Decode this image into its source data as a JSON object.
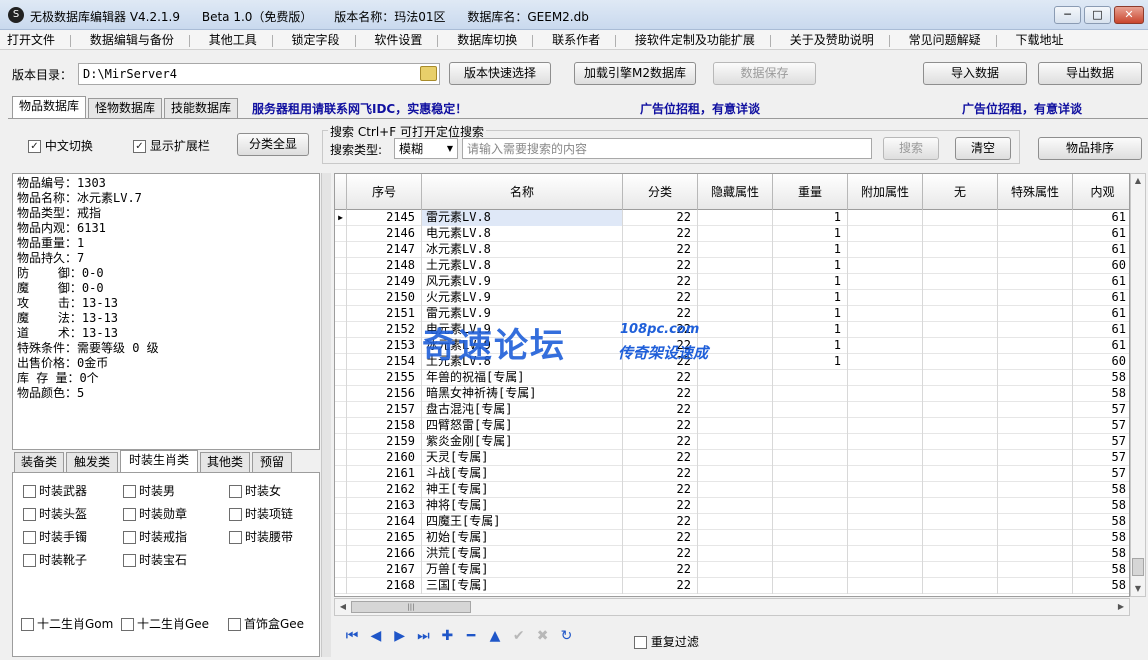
{
  "window": {
    "title_segments": [
      "无极数据库编辑器 V4.2.1.9",
      "Beta 1.0（免费版）",
      "版本名称：玛法01区",
      "数据库名：GEEM2.db"
    ],
    "controls": [
      "─",
      "□",
      "✕"
    ]
  },
  "menu": [
    "打开文件",
    "数据编辑与备份",
    "其他工具",
    "锁定字段",
    "软件设置",
    "数据库切换",
    "联系作者",
    "接软件定制及功能扩展",
    "关于及赞助说明",
    "常见问题解疑",
    "下载地址"
  ],
  "toolbar": {
    "dir_label": "版本目录：",
    "dir_value": "D:\\MirServer4",
    "quick_select": "版本快速选择",
    "load_engine": "加载引擎M2数据库",
    "save_data": "数据保存",
    "import_data": "导入数据",
    "export_data": "导出数据"
  },
  "tabs": [
    "物品数据库",
    "怪物数据库",
    "技能数据库"
  ],
  "ads": [
    "服务器租用请联系网飞IDC，实惠稳定！",
    "广告位招租，有意详谈",
    "广告位招租，有意详谈"
  ],
  "options": {
    "chinese_toggle": "中文切换",
    "show_ext_bar": "显示扩展栏",
    "show_all_categories": "分类全显"
  },
  "search": {
    "title": "搜索   Ctrl+F 可打开定位搜索",
    "type_label": "搜索类型:",
    "type_value": "模糊",
    "placeholder": "请输入需要搜索的内容",
    "search_button": "搜索",
    "clear_button": "清空",
    "sort_button": "物品排序"
  },
  "item_info": [
    "物品编号：1303",
    "物品名称：冰元素LV.7",
    "物品类型：戒指",
    "物品内观：6131",
    "物品重量：1",
    "物品持久：7",
    "防    御：0-0",
    "魔    御：0-0",
    "攻    击：13-13",
    "魔    法：13-13",
    "道    术：13-13",
    "特殊条件：需要等级 0 级",
    "出售价格：0金币",
    "库 存 量：0个",
    "物品颜色：5"
  ],
  "category_tabs": [
    "装备类",
    "触发类",
    "时装生肖类",
    "其他类",
    "预留"
  ],
  "category_checks": [
    [
      "时装武器",
      "时装男",
      "时装女"
    ],
    [
      "时装头盔",
      "时装勋章",
      "时装项链"
    ],
    [
      "时装手镯",
      "时装戒指",
      "时装腰带"
    ],
    [
      "时装靴子",
      "时装宝石"
    ]
  ],
  "bottom_checks": [
    "十二生肖Gom",
    "十二生肖Gee",
    "首饰盒Gee"
  ],
  "grid": {
    "columns": [
      "序号",
      "名称",
      "分类",
      "隐藏属性",
      "重量",
      "附加属性",
      "无",
      "特殊属性",
      "内观"
    ],
    "rows": [
      [
        "2145",
        "雷元素LV.8",
        "22",
        "",
        "1",
        "",
        "",
        "",
        "61"
      ],
      [
        "2146",
        "电元素LV.8",
        "22",
        "",
        "1",
        "",
        "",
        "",
        "61"
      ],
      [
        "2147",
        "冰元素LV.8",
        "22",
        "",
        "1",
        "",
        "",
        "",
        "61"
      ],
      [
        "2148",
        "土元素LV.8",
        "22",
        "",
        "1",
        "",
        "",
        "",
        "60"
      ],
      [
        "2149",
        "风元素LV.9",
        "22",
        "",
        "1",
        "",
        "",
        "",
        "61"
      ],
      [
        "2150",
        "火元素LV.9",
        "22",
        "",
        "1",
        "",
        "",
        "",
        "61"
      ],
      [
        "2151",
        "雷元素LV.9",
        "22",
        "",
        "1",
        "",
        "",
        "",
        "61"
      ],
      [
        "2152",
        "电元素LV.9",
        "22",
        "",
        "1",
        "",
        "",
        "",
        "61"
      ],
      [
        "2153",
        "冰元素LV.9",
        "22",
        "",
        "1",
        "",
        "",
        "",
        "61"
      ],
      [
        "2154",
        "土元素LV.8",
        "22",
        "",
        "1",
        "",
        "",
        "",
        "60"
      ],
      [
        "2155",
        "年兽的祝福[专属]",
        "22",
        "",
        "",
        "",
        "",
        "",
        "58"
      ],
      [
        "2156",
        "暗黑女神祈祷[专属]",
        "22",
        "",
        "",
        "",
        "",
        "",
        "58"
      ],
      [
        "2157",
        "盘古混沌[专属]",
        "22",
        "",
        "",
        "",
        "",
        "",
        "57"
      ],
      [
        "2158",
        "四臂怒雷[专属]",
        "22",
        "",
        "",
        "",
        "",
        "",
        "57"
      ],
      [
        "2159",
        "紫炎金刚[专属]",
        "22",
        "",
        "",
        "",
        "",
        "",
        "57"
      ],
      [
        "2160",
        "天灵[专属]",
        "22",
        "",
        "",
        "",
        "",
        "",
        "57"
      ],
      [
        "2161",
        "斗战[专属]",
        "22",
        "",
        "",
        "",
        "",
        "",
        "57"
      ],
      [
        "2162",
        "神王[专属]",
        "22",
        "",
        "",
        "",
        "",
        "",
        "58"
      ],
      [
        "2163",
        "神将[专属]",
        "22",
        "",
        "",
        "",
        "",
        "",
        "58"
      ],
      [
        "2164",
        "四魔王[专属]",
        "22",
        "",
        "",
        "",
        "",
        "",
        "58"
      ],
      [
        "2165",
        "初始[专属]",
        "22",
        "",
        "",
        "",
        "",
        "",
        "58"
      ],
      [
        "2166",
        "洪荒[专属]",
        "22",
        "",
        "",
        "",
        "",
        "",
        "58"
      ],
      [
        "2167",
        "万兽[专属]",
        "22",
        "",
        "",
        "",
        "",
        "",
        "58"
      ],
      [
        "2168",
        "三国[专属]",
        "22",
        "",
        "",
        "",
        "",
        "",
        "58"
      ]
    ]
  },
  "navigator": {
    "icons": [
      "first-icon",
      "prior-icon",
      "next-icon",
      "last-icon",
      "insert-icon",
      "delete-icon",
      "edit-icon",
      "post-icon",
      "cancel-icon",
      "refresh-icon"
    ],
    "dedupe_label": "重复过滤"
  },
  "watermark": {
    "main": "奇速论坛",
    "url": "108pc.com",
    "sub": "传奇架设速成"
  }
}
